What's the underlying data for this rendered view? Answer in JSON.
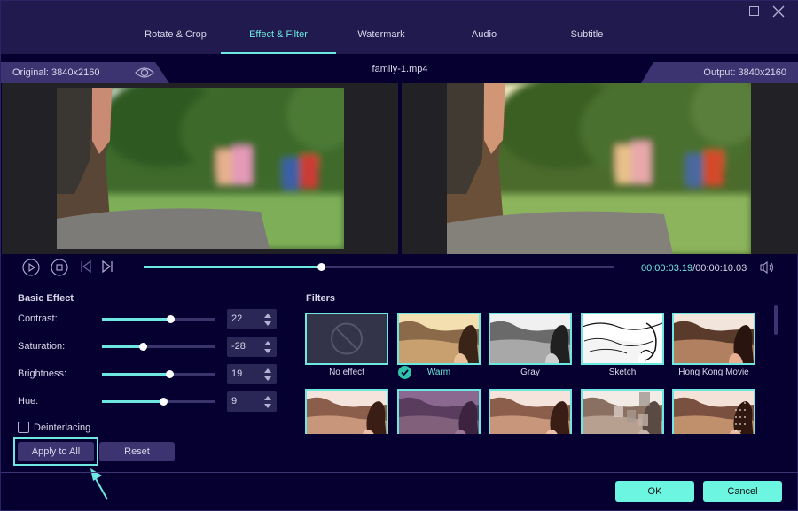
{
  "window": {
    "maximize_icon": "maximize-icon",
    "close_icon": "close-icon"
  },
  "tabs": [
    {
      "label": "Rotate & Crop",
      "active": false
    },
    {
      "label": "Effect & Filter",
      "active": true
    },
    {
      "label": "Watermark",
      "active": false
    },
    {
      "label": "Audio",
      "active": false
    },
    {
      "label": "Subtitle",
      "active": false
    }
  ],
  "info": {
    "original": "Original: 3840x2160",
    "filename": "family-1.mp4",
    "output": "Output: 3840x2160"
  },
  "playback": {
    "current_time": "00:00:03.19",
    "total_time": "/00:00:10.03",
    "progress_percent": 37.6
  },
  "basic_effect": {
    "title": "Basic Effect",
    "params": [
      {
        "label": "Contrast:",
        "value": "22",
        "slider_percent": 60
      },
      {
        "label": "Saturation:",
        "value": "-28",
        "slider_percent": 36
      },
      {
        "label": "Brightness:",
        "value": "19",
        "slider_percent": 59
      },
      {
        "label": "Hue:",
        "value": "9",
        "slider_percent": 54
      }
    ],
    "deinterlacing_label": "Deinterlacing",
    "deinterlacing_checked": false,
    "apply_all_label": "Apply to All",
    "reset_label": "Reset"
  },
  "filters": {
    "title": "Filters",
    "items": [
      {
        "name": "No effect",
        "selected": false,
        "tone": "none"
      },
      {
        "name": "Warm",
        "selected": true,
        "tone": "warm"
      },
      {
        "name": "Gray",
        "selected": false,
        "tone": "gray"
      },
      {
        "name": "Sketch",
        "selected": false,
        "tone": "sketch"
      },
      {
        "name": "Hong Kong Movie",
        "selected": false,
        "tone": "hongkong"
      },
      {
        "name": "",
        "selected": false,
        "tone": "rose"
      },
      {
        "name": "",
        "selected": false,
        "tone": "purple"
      },
      {
        "name": "",
        "selected": false,
        "tone": "rose"
      },
      {
        "name": "",
        "selected": false,
        "tone": "mosaic"
      },
      {
        "name": "",
        "selected": false,
        "tone": "dots"
      }
    ]
  },
  "footer": {
    "ok_label": "OK",
    "cancel_label": "Cancel"
  },
  "colors": {
    "accent": "#6ee7e0",
    "background": "#060030",
    "header": "#201a4e",
    "panel": "#3c3471",
    "primary_button": "#6cf5e0"
  }
}
